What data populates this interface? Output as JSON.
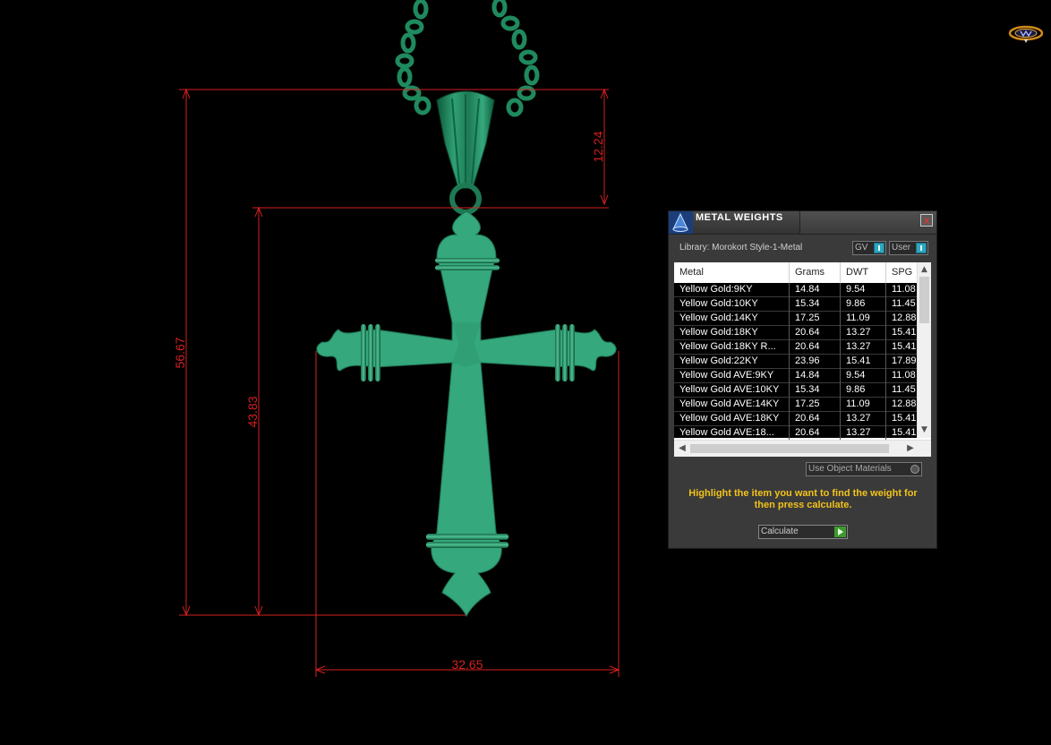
{
  "dimensions": {
    "total_height": "56.67",
    "body_height": "43.83",
    "bail_height": "12.24",
    "width": "32.65"
  },
  "panel": {
    "title": "METAL WEIGHTS",
    "close_label": "x",
    "library_label": "Library: Morokort Style-1-Metal",
    "gv_label": "GV",
    "user_label": "User",
    "columns": [
      "Metal",
      "Grams",
      "DWT",
      "SPG"
    ],
    "rows": [
      [
        "Yellow Gold:9KY",
        "14.84",
        "9.54",
        "11.08"
      ],
      [
        "Yellow Gold:10KY",
        "15.34",
        "9.86",
        "11.45"
      ],
      [
        "Yellow Gold:14KY",
        "17.25",
        "11.09",
        "12.88"
      ],
      [
        "Yellow Gold:18KY",
        "20.64",
        "13.27",
        "15.41"
      ],
      [
        "Yellow Gold:18KY R...",
        "20.64",
        "13.27",
        "15.41"
      ],
      [
        "Yellow Gold:22KY",
        "23.96",
        "15.41",
        "17.89"
      ],
      [
        "Yellow Gold AVE:9KY",
        "14.84",
        "9.54",
        "11.08"
      ],
      [
        "Yellow Gold AVE:10KY",
        "15.34",
        "9.86",
        "11.45"
      ],
      [
        "Yellow Gold AVE:14KY",
        "17.25",
        "11.09",
        "12.88"
      ],
      [
        "Yellow Gold AVE:18KY",
        "20.64",
        "13.27",
        "15.41"
      ],
      [
        "Yellow Gold AVE:18...",
        "20.64",
        "13.27",
        "15.41"
      ]
    ],
    "use_object_materials_label": "Use Object Materials",
    "hint": "Highlight the item you want to find the weight for then press calculate.",
    "calculate_label": "Calculate"
  },
  "colors": {
    "model_green": "#35a87d",
    "dimension_red": "#d42020",
    "hint_yellow": "#f2c21a",
    "toggle_cyan": "#2da7c0"
  },
  "icons": {
    "logo": "app-logo-icon",
    "panel": "cone-icon",
    "close": "close-icon",
    "calculate": "play-icon"
  }
}
